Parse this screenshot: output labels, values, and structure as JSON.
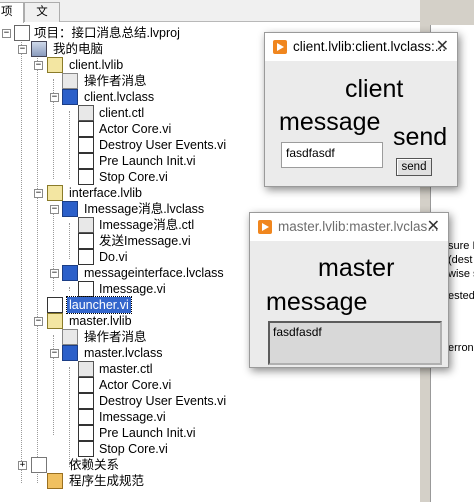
{
  "tabs": {
    "project": "项",
    "file": "文件"
  },
  "tree": {
    "root": "项目：接口消息总结.lvproj",
    "my_computer": "我的电脑",
    "client_lib": "client.lvlib",
    "client_actor_msgs": "操作者消息",
    "client_class": "client.lvclass",
    "client_ctl": "client.ctl",
    "client_actor_core": "Actor Core.vi",
    "client_destroy": "Destroy User Events.vi",
    "client_prelaunch": "Pre Launch Init.vi",
    "client_stop": "Stop Core.vi",
    "interface_lib": "interface.lvlib",
    "imessage_class": "Imessage消息.lvclass",
    "imessage_ctl": "Imessage消息.ctl",
    "send_imessage": "发送Imessage.vi",
    "do_vi": "Do.vi",
    "messageinterface_class": "messageinterface.lvclass",
    "imessage_vi": "Imessage.vi",
    "launcher": "launcher.vi",
    "master_lib": "master.lvlib",
    "master_actor_msgs": "操作者消息",
    "master_class": "master.lvclass",
    "master_ctl": "master.ctl",
    "master_actor_core": "Actor Core.vi",
    "master_destroy": "Destroy User Events.vi",
    "master_imessage": "Imessage.vi",
    "master_prelaunch": "Pre Launch Init.vi",
    "master_stop": "Stop Core.vi",
    "dependencies": "依赖关系",
    "build_specs": "程序生成规范"
  },
  "client_window": {
    "title": "client.lvlib:client.lvclass:...",
    "label_client": "client",
    "label_message": "message",
    "label_send": "send",
    "input_value": "fasdfasdf",
    "send_button": "send"
  },
  "master_window": {
    "title": "master.lvlib:master.lvclas...",
    "label_master": "master",
    "label_message": "message",
    "display_value": "fasdfasdf"
  },
  "right_fragments": {
    "a": "sure E",
    "b": "(dest",
    "c": "wise s",
    "d": "ested",
    "e": "erron"
  }
}
